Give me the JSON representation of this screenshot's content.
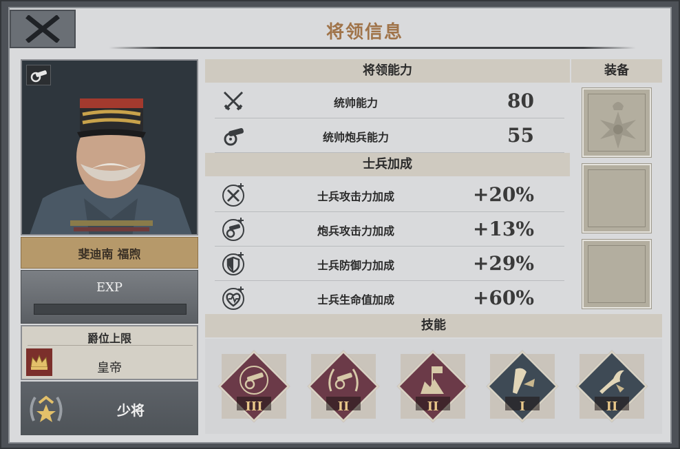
{
  "window": {
    "title": "将领信息"
  },
  "general": {
    "name": "斐迪南 福煦",
    "exp_label": "EXP",
    "exp_progress": 0.0,
    "peerage_cap_label": "爵位上限",
    "peerage_cap_value": "皇帝",
    "military_rank": "少将"
  },
  "abilities": {
    "header": "将领能力",
    "rows": [
      {
        "icon": "crossed-swords-icon",
        "label": "统帅能力",
        "value": "80"
      },
      {
        "icon": "cannon-icon",
        "label": "统帅炮兵能力",
        "value": "55"
      }
    ]
  },
  "bonuses": {
    "header": "士兵加成",
    "rows": [
      {
        "icon": "swords-plus-icon",
        "label": "士兵攻击力加成",
        "value": "+20%"
      },
      {
        "icon": "cannon-plus-icon",
        "label": "炮兵攻击力加成",
        "value": "+13%"
      },
      {
        "icon": "shield-plus-icon",
        "label": "士兵防御力加成",
        "value": "+29%"
      },
      {
        "icon": "heart-plus-icon",
        "label": "士兵生命值加成",
        "value": "+60%"
      }
    ]
  },
  "equipment": {
    "header": "装备",
    "slots": [
      {
        "icon": "iron-cross-icon",
        "filled": true
      },
      {
        "icon": "",
        "filled": false
      },
      {
        "icon": "",
        "filled": false
      }
    ]
  },
  "skills": {
    "header": "技能",
    "items": [
      {
        "icon": "cannon-emblem-icon",
        "level": "III",
        "color": "#6b3a48"
      },
      {
        "icon": "cannon-laurel-icon",
        "level": "II",
        "color": "#6b3a48"
      },
      {
        "icon": "fortress-flag-icon",
        "level": "II",
        "color": "#6b3a48"
      },
      {
        "icon": "bugle-icon",
        "level": "I",
        "color": "#3e4a55"
      },
      {
        "icon": "horn-icon",
        "level": "II",
        "color": "#3e4a55"
      }
    ]
  },
  "colors": {
    "title": "#a0744a",
    "name_plate": "#b6996a",
    "skill_level": "#e8c78a"
  }
}
